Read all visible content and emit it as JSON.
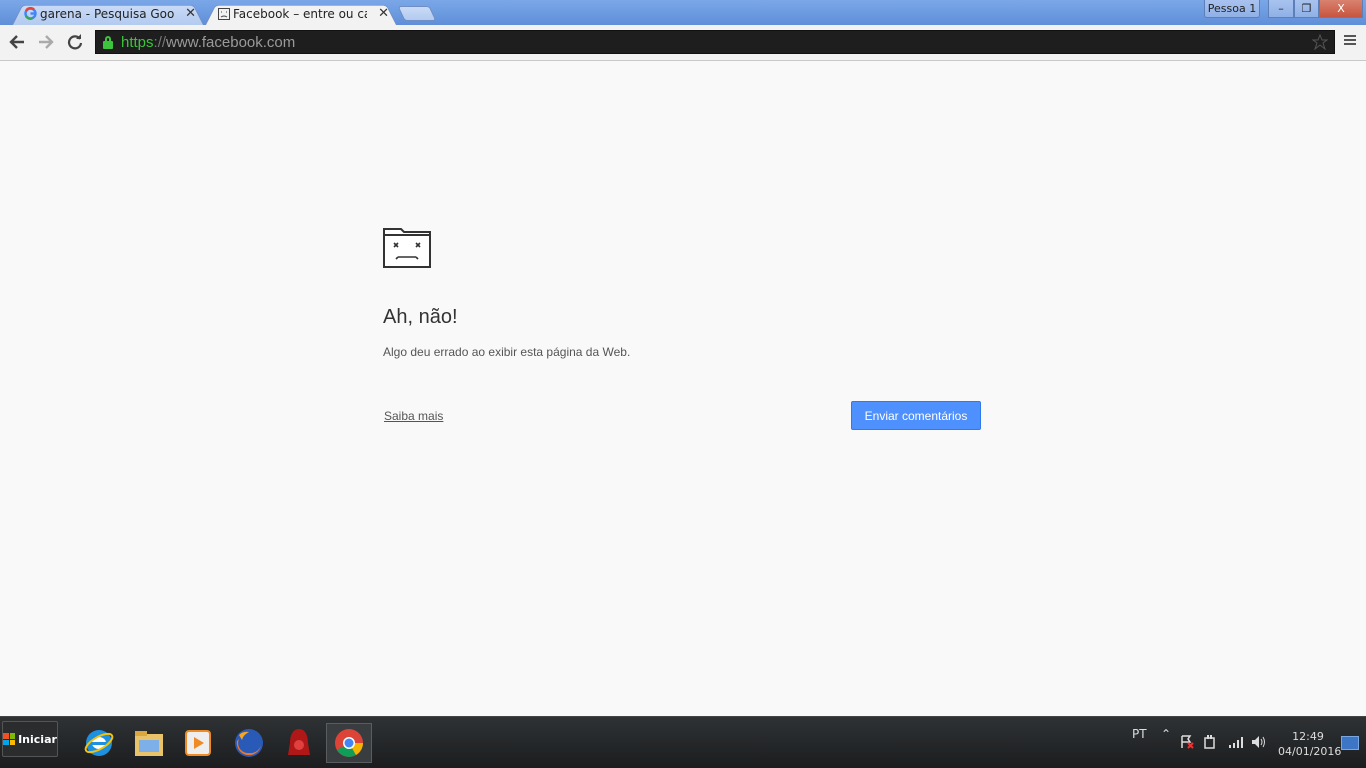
{
  "browser": {
    "tabs": [
      {
        "title": "garena - Pesquisa Google",
        "favicon": "google-favicon",
        "active": false
      },
      {
        "title": "Facebook – entre ou cadastre-se",
        "favicon": "sad-page-favicon",
        "active": true
      }
    ],
    "profile_label": "Pessoa 1",
    "window_buttons": {
      "minimize": "–",
      "restore": "❐",
      "close": "X"
    },
    "url": {
      "scheme": "https",
      "separator": "://",
      "host": "www.facebook.com"
    }
  },
  "error_page": {
    "icon": "sad-folder-icon",
    "title": "Ah, não!",
    "message": "Algo deu errado ao exibir esta página da Web.",
    "learn_more": "Saiba mais",
    "feedback_button": "Enviar comentários"
  },
  "taskbar": {
    "start_label": "Iniciar",
    "apps": [
      "internet-explorer-icon",
      "file-explorer-icon",
      "media-player-icon",
      "firefox-icon",
      "garena-icon",
      "chrome-icon"
    ],
    "language": "PT",
    "time": "12:49",
    "date": "04/01/2016"
  },
  "colors": {
    "accent": "#4d90fe",
    "secure": "#3cc43c",
    "titlebar": "#6f9be0"
  }
}
